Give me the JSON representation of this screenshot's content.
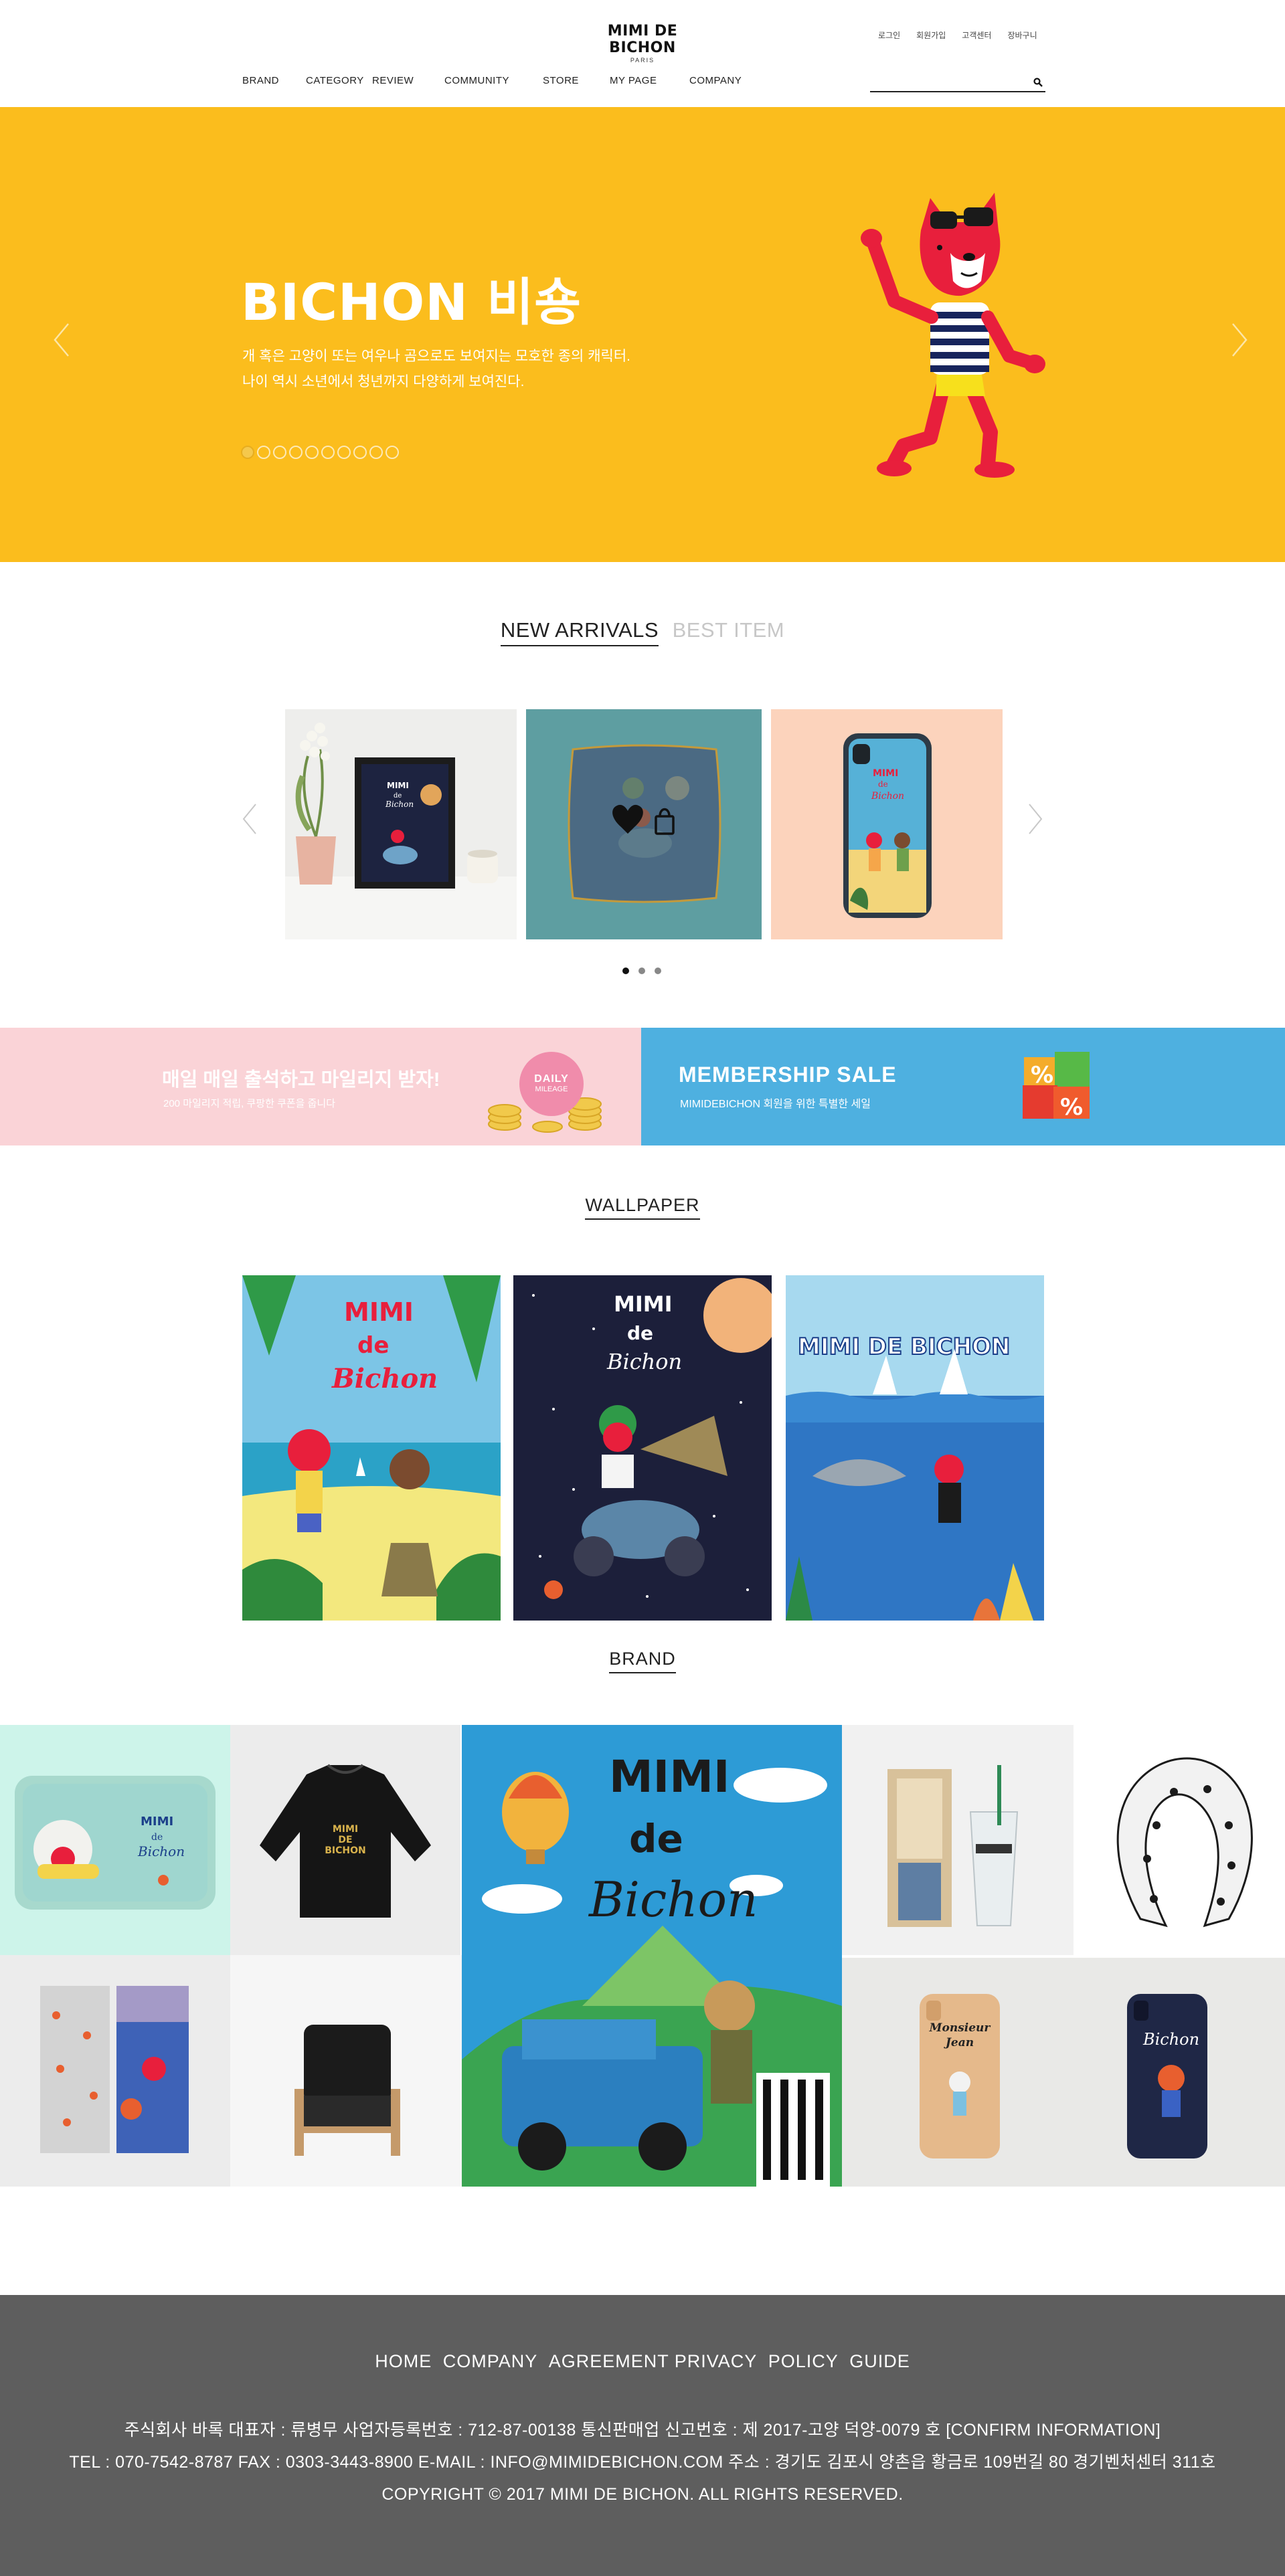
{
  "header": {
    "logo_main": "MIMI DE BICHON",
    "logo_sub": "PARIS",
    "util_links": [
      "로그인",
      "회원가입",
      "고객센터",
      "장바구니"
    ],
    "nav": [
      "BRAND",
      "CATEGORY",
      "REVIEW",
      "COMMUNITY",
      "STORE",
      "MY PAGE",
      "COMPANY"
    ],
    "search_placeholder": ""
  },
  "hero": {
    "title": "BICHON 비숑",
    "desc_line1": "개 혹은 고양이 또는 여우나 곰으로도 보여지는 모호한 종의 캐릭터.",
    "desc_line2": "나이 역시 소년에서 청년까지 다양하게 보여진다.",
    "slide_count": 10,
    "active_slide": 1,
    "background": "#fbbd1d"
  },
  "products": {
    "tabs": [
      "NEW ARRIVALS",
      "BEST ITEM"
    ],
    "active_tab": "NEW ARRIVALS",
    "items": [
      {
        "name": "framed-print"
      },
      {
        "name": "cushion"
      },
      {
        "name": "phone-case"
      }
    ],
    "page_count": 3,
    "active_page": 1
  },
  "banners": {
    "daily": {
      "title": "매일 매일 출석하고 마일리지 받자!",
      "subtitle": "200 마일리지 적립, 쿠팡한 쿠폰을 줍니다",
      "badge_line1": "DAILY",
      "badge_line2": "MILEAGE",
      "color": "#fad3d7"
    },
    "membership": {
      "title": "MEMBERSHIP SALE",
      "subtitle": "MIMIDEBICHON 회원을 위한 특별한 세일",
      "color": "#4eb0e0"
    }
  },
  "wallpaper": {
    "title": "WALLPAPER",
    "items": [
      {
        "art_text_1": "MIMI",
        "art_text_2": "de",
        "art_text_3": "Bichon"
      },
      {
        "art_text_1": "MIMI",
        "art_text_2": "de",
        "art_text_3": "Bichon"
      },
      {
        "art_text_1": "MIMI DE BICHON"
      }
    ]
  },
  "brand": {
    "title": "BRAND",
    "poster_text_1": "MIMI",
    "poster_text_2": "de",
    "poster_text_3": "Bichon",
    "sweater_text": "MIMI DE BICHON",
    "phone_text_1": "Monsieur Jean",
    "phone_text_2": "Bichon"
  },
  "footer": {
    "nav": [
      "HOME",
      "COMPANY",
      "AGREEMENT PRIVACY",
      "POLICY",
      "GUIDE"
    ],
    "line1": "주식회사 바록 대표자 : 류병무 사업자등록번호 : 712-87-00138 통신판매업 신고번호 : 제 2017-고양 덕양-0079 호 [CONFIRM INFORMATION]",
    "line2": "TEL : 070-7542-8787 FAX : 0303-3443-8900 E-MAIL : INFO@MIMIDEBICHON.COM 주소 : 경기도 김포시 양촌읍 황금로 109번길 80 경기벤처센터 311호",
    "line3": "COPYRIGHT © 2017 MIMI DE BICHON. ALL RIGHTS RESERVED.",
    "color": "#5e5e5e"
  }
}
